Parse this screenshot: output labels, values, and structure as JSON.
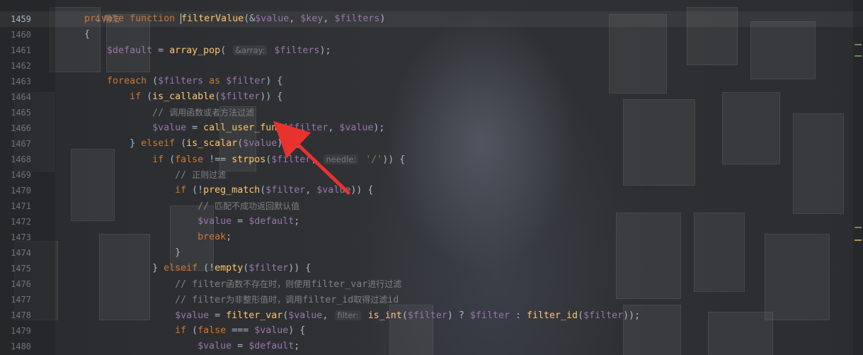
{
  "editor": {
    "usage_hint": "4 用法",
    "lines": [
      {
        "n": "1459",
        "tokens": [
          [
            "    ",
            "plain"
          ],
          [
            "private ",
            "kw"
          ],
          [
            "function ",
            "kw"
          ],
          [
            "filterValue",
            "fn"
          ],
          [
            "(&",
            "plain"
          ],
          [
            "$value",
            "var"
          ],
          [
            ", ",
            "plain"
          ],
          [
            "$key",
            "var"
          ],
          [
            ", ",
            "plain"
          ],
          [
            "$filters",
            "var"
          ],
          [
            ")",
            "plain"
          ]
        ]
      },
      {
        "n": "1460",
        "tokens": [
          [
            "    {",
            "plain"
          ]
        ]
      },
      {
        "n": "1461",
        "tokens": [
          [
            "        ",
            "plain"
          ],
          [
            "$default",
            "var"
          ],
          [
            " = ",
            "plain"
          ],
          [
            "array_pop",
            "fn"
          ],
          [
            "( ",
            "plain"
          ],
          [
            "&array:",
            "hint"
          ],
          [
            " ",
            "plain"
          ],
          [
            "$filters",
            "var"
          ],
          [
            ");",
            "plain"
          ]
        ]
      },
      {
        "n": "1462",
        "tokens": []
      },
      {
        "n": "1463",
        "tokens": [
          [
            "        ",
            "plain"
          ],
          [
            "foreach ",
            "kw"
          ],
          [
            "(",
            "plain"
          ],
          [
            "$filters",
            "var"
          ],
          [
            " as ",
            "kw"
          ],
          [
            "$filter",
            "var"
          ],
          [
            ") {",
            "plain"
          ]
        ]
      },
      {
        "n": "1464",
        "tokens": [
          [
            "            ",
            "plain"
          ],
          [
            "if ",
            "kw"
          ],
          [
            "(",
            "plain"
          ],
          [
            "is_callable",
            "fn"
          ],
          [
            "(",
            "plain"
          ],
          [
            "$filter",
            "var"
          ],
          [
            ")) {",
            "plain"
          ]
        ]
      },
      {
        "n": "1465",
        "tokens": [
          [
            "                ",
            "plain"
          ],
          [
            "// ",
            "cm"
          ],
          [
            "调用函数或者方法过滤",
            "cmz"
          ]
        ]
      },
      {
        "n": "1466",
        "tokens": [
          [
            "                ",
            "plain"
          ],
          [
            "$value",
            "var"
          ],
          [
            " = ",
            "plain"
          ],
          [
            "call_user_func",
            "fn"
          ],
          [
            "(",
            "plain"
          ],
          [
            "$filter",
            "var"
          ],
          [
            ", ",
            "plain"
          ],
          [
            "$value",
            "var"
          ],
          [
            ");",
            "plain"
          ]
        ]
      },
      {
        "n": "1467",
        "tokens": [
          [
            "            ",
            "plain"
          ],
          [
            "} ",
            "plain"
          ],
          [
            "elseif ",
            "kw"
          ],
          [
            "(",
            "plain"
          ],
          [
            "is_scalar",
            "fn"
          ],
          [
            "(",
            "plain"
          ],
          [
            "$value",
            "var"
          ],
          [
            ")) {",
            "plain"
          ]
        ]
      },
      {
        "n": "1468",
        "tokens": [
          [
            "                ",
            "plain"
          ],
          [
            "if ",
            "kw"
          ],
          [
            "(",
            "plain"
          ],
          [
            "false ",
            "kw"
          ],
          [
            "!== ",
            "plain"
          ],
          [
            "strpos",
            "fn"
          ],
          [
            "(",
            "plain"
          ],
          [
            "$filter",
            "var"
          ],
          [
            ", ",
            "plain"
          ],
          [
            "needle:",
            "hint"
          ],
          [
            " ",
            "plain"
          ],
          [
            "'/'",
            "str"
          ],
          [
            ")) {",
            "plain"
          ]
        ]
      },
      {
        "n": "1469",
        "tokens": [
          [
            "                    ",
            "plain"
          ],
          [
            "// ",
            "cm"
          ],
          [
            "正则过滤",
            "cmz"
          ]
        ]
      },
      {
        "n": "1470",
        "tokens": [
          [
            "                    ",
            "plain"
          ],
          [
            "if ",
            "kw"
          ],
          [
            "(!",
            "plain"
          ],
          [
            "preg_match",
            "fn"
          ],
          [
            "(",
            "plain"
          ],
          [
            "$filter",
            "var"
          ],
          [
            ", ",
            "plain"
          ],
          [
            "$value",
            "var"
          ],
          [
            ")) {",
            "plain"
          ]
        ]
      },
      {
        "n": "1471",
        "tokens": [
          [
            "                        ",
            "plain"
          ],
          [
            "// ",
            "cm"
          ],
          [
            "匹配不成功返回默认值",
            "cmz"
          ]
        ]
      },
      {
        "n": "1472",
        "tokens": [
          [
            "                        ",
            "plain"
          ],
          [
            "$value",
            "var"
          ],
          [
            " = ",
            "plain"
          ],
          [
            "$default",
            "var"
          ],
          [
            ";",
            "plain"
          ]
        ]
      },
      {
        "n": "1473",
        "tokens": [
          [
            "                        ",
            "plain"
          ],
          [
            "break",
            "kw"
          ],
          [
            ";",
            "plain"
          ]
        ]
      },
      {
        "n": "1474",
        "tokens": [
          [
            "                    ",
            "plain"
          ],
          [
            "}",
            "plain"
          ]
        ]
      },
      {
        "n": "1475",
        "tokens": [
          [
            "                ",
            "plain"
          ],
          [
            "} ",
            "plain"
          ],
          [
            "elseif ",
            "kw"
          ],
          [
            "(!",
            "plain"
          ],
          [
            "empty",
            "fn"
          ],
          [
            "(",
            "plain"
          ],
          [
            "$filter",
            "var"
          ],
          [
            ")) {",
            "plain"
          ]
        ]
      },
      {
        "n": "1476",
        "tokens": [
          [
            "                    ",
            "plain"
          ],
          [
            "// filter",
            "cm"
          ],
          [
            "函数不存在时，则使用",
            "cmz"
          ],
          [
            "filter_var",
            "cm"
          ],
          [
            "进行过滤",
            "cmz"
          ]
        ]
      },
      {
        "n": "1477",
        "tokens": [
          [
            "                    ",
            "plain"
          ],
          [
            "// filter",
            "cm"
          ],
          [
            "为非整形值时，调用",
            "cmz"
          ],
          [
            "filter_id",
            "cm"
          ],
          [
            "取得过滤",
            "cmz"
          ],
          [
            "id",
            "cm"
          ]
        ]
      },
      {
        "n": "1478",
        "tokens": [
          [
            "                    ",
            "plain"
          ],
          [
            "$value",
            "var"
          ],
          [
            " = ",
            "plain"
          ],
          [
            "filter_var",
            "fn"
          ],
          [
            "(",
            "plain"
          ],
          [
            "$value",
            "var"
          ],
          [
            ", ",
            "plain"
          ],
          [
            "filter:",
            "hint"
          ],
          [
            " ",
            "plain"
          ],
          [
            "is_int",
            "fn"
          ],
          [
            "(",
            "plain"
          ],
          [
            "$filter",
            "var"
          ],
          [
            ") ? ",
            "plain"
          ],
          [
            "$filter",
            "var"
          ],
          [
            " : ",
            "plain"
          ],
          [
            "filter_id",
            "fn"
          ],
          [
            "(",
            "plain"
          ],
          [
            "$filter",
            "var"
          ],
          [
            "));",
            "plain"
          ]
        ]
      },
      {
        "n": "1479",
        "tokens": [
          [
            "                    ",
            "plain"
          ],
          [
            "if ",
            "kw"
          ],
          [
            "(",
            "plain"
          ],
          [
            "false ",
            "kw"
          ],
          [
            "=== ",
            "plain"
          ],
          [
            "$value",
            "var"
          ],
          [
            ") {",
            "plain"
          ]
        ]
      },
      {
        "n": "1480",
        "tokens": [
          [
            "                        ",
            "plain"
          ],
          [
            "$value",
            "var"
          ],
          [
            " = ",
            "plain"
          ],
          [
            "$default",
            "var"
          ],
          [
            ";",
            "plain"
          ]
        ]
      }
    ]
  },
  "colors": {
    "keyword": "#cc7832",
    "function": "#ffc66d",
    "variable": "#9876aa",
    "string": "#6a8759",
    "comment": "#808080",
    "arrow": "#e8322e"
  }
}
